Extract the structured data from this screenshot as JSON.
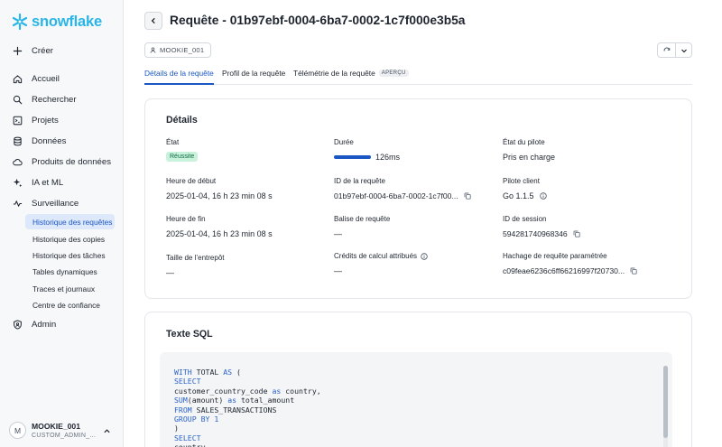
{
  "brand": {
    "name": "snowflake",
    "color": "#29b5e8"
  },
  "sidebar": {
    "create": "Créer",
    "items": [
      {
        "label": "Accueil",
        "icon": "home-icon"
      },
      {
        "label": "Rechercher",
        "icon": "search-icon"
      },
      {
        "label": "Projets",
        "icon": "projects-icon"
      },
      {
        "label": "Données",
        "icon": "database-icon"
      },
      {
        "label": "Produits de données",
        "icon": "cloud-icon"
      },
      {
        "label": "IA et ML",
        "icon": "sparkle-icon"
      },
      {
        "label": "Surveillance",
        "icon": "activity-icon"
      }
    ],
    "sub_items": [
      "Historique des requêtes",
      "Historique des copies",
      "Historique des tâches",
      "Tables dynamiques",
      "Traces et journaux",
      "Centre de confiance"
    ],
    "admin": "Admin",
    "user": {
      "initial": "M",
      "name": "MOOKIE_001",
      "role": "CUSTOM_ADMIN_..."
    }
  },
  "header": {
    "title": "Requête - 01b97ebf-0004-6ba7-0002-1c7f000e3b5a",
    "user_chip": "MOOKIE_001"
  },
  "tabs": [
    {
      "label": "Détails de la requête"
    },
    {
      "label": "Profil de la requête"
    },
    {
      "label": "Télémétrie de la requête",
      "badge": "APERÇU"
    }
  ],
  "details": {
    "title": "Détails",
    "status_label": "État",
    "status_value": "Réussite",
    "duration_label": "Durée",
    "duration_value": "126ms",
    "duration_fraction": 1.0,
    "driver_state_label": "État du pilote",
    "driver_state_value": "Pris en charge",
    "start_label": "Heure de début",
    "start_value": "2025-01-04, 16 h 23 min 08 s",
    "query_id_label": "ID de la requête",
    "query_id_value": "01b97ebf-0004-6ba7-0002-1c7f00...",
    "client_driver_label": "Pilote client",
    "client_driver_value": "Go 1.1.5",
    "end_label": "Heure de fin",
    "end_value": "2025-01-04, 16 h 23 min 08 s",
    "query_tag_label": "Balise de requête",
    "query_tag_value": "—",
    "session_id_label": "ID de session",
    "session_id_value": "594281740968346",
    "warehouse_size_label": "Taille de l’entrepôt",
    "warehouse_size_value": "—",
    "credits_label": "Crédits de calcul attribués",
    "credits_value": "—",
    "hash_label": "Hachage de requête paramétrée",
    "hash_value": "c09feae6236c6ff66216997f20730..."
  },
  "sql": {
    "title": "Texte SQL",
    "lines": [
      "WITH TOTAL AS (",
      "SELECT",
      "customer_country_code as country,",
      "SUM(amount) as total_amount",
      "FROM SALES_TRANSACTIONS",
      "GROUP BY 1",
      ")",
      "SELECT",
      "country,"
    ]
  },
  "colors": {
    "accent": "#1a56c4",
    "success_bg": "#c9f2dc",
    "success_text": "#0f6b3e",
    "active_nav_bg": "#dde9fb"
  }
}
